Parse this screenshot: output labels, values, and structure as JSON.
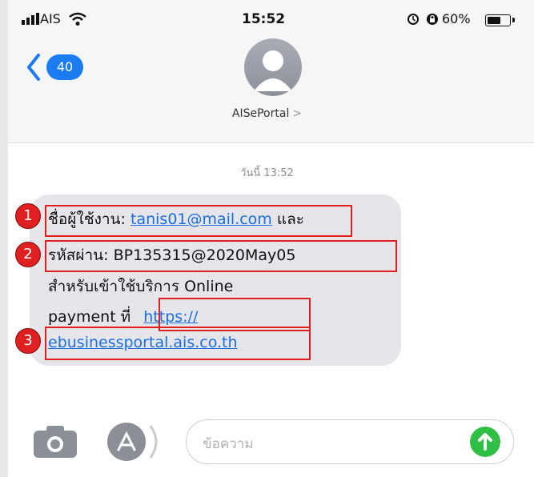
{
  "status_bar": {
    "carrier": "AIS",
    "time": "15:52",
    "battery_percent": "60%",
    "battery_level": 0.6
  },
  "nav": {
    "unread_count": "40",
    "contact_name": "AISePortal",
    "contact_chevron": ">"
  },
  "conversation": {
    "timestamp": "วันนี้ 13:52",
    "message": {
      "username_label": "ชื่อผู้ใช้งาน:",
      "username_value": "tanis01@mail.com",
      "and_word": "และ",
      "password_label": "รหัสผ่าน:",
      "password_value": "BP135315@2020May05",
      "line3": "สำหรับเข้าใช้บริการ Online",
      "line4_text": "payment ที่",
      "link_part1": "https://",
      "link_part2": "ebusinessportal.ais.co.th"
    }
  },
  "annotations": [
    "1",
    "2",
    "3"
  ],
  "input_bar": {
    "placeholder": "ข้อความ"
  },
  "icons": [
    "signal-icon",
    "wifi-icon",
    "alarm-icon",
    "orientation-lock-icon",
    "battery-icon",
    "back-chevron-icon",
    "contact-avatar-icon",
    "camera-icon",
    "app-store-icon",
    "send-arrow-icon"
  ],
  "colors": {
    "accent_blue": "#1a7cf0",
    "link_blue": "#1a6fe0",
    "bubble_gray": "#e5e5ea",
    "annotation_red": "#e02020",
    "send_green": "#2fbf45"
  }
}
